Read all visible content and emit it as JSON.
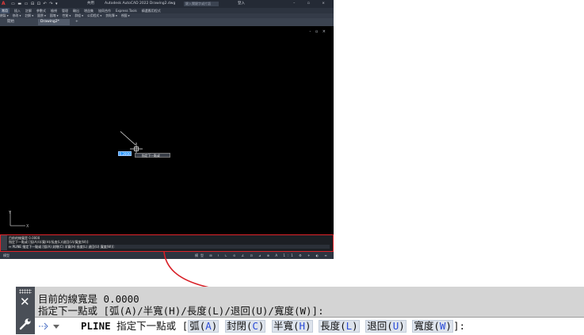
{
  "titlebar": {
    "logo": "A",
    "share": "共用",
    "title": "Autodesk AutoCAD 2022    Drawing2.dwg",
    "search_placeholder": "鍵入關鍵字或片語",
    "user": "登入"
  },
  "ribbon_tabs": [
    "常用",
    "插入",
    "註解",
    "參數式",
    "檢視",
    "管理",
    "輸出",
    "增益集",
    "協同合作",
    "Express Tools",
    "精選應用程式"
  ],
  "ribbon_panels": [
    "繪製",
    "修改",
    "註解",
    "圖層",
    "圖塊",
    "性質",
    "群組",
    "公用程式",
    "剪貼簿",
    "視圖"
  ],
  "doc_tabs": {
    "start": "開始",
    "drawing": "Drawing2*",
    "add": "+"
  },
  "viewport_controls": "- ▫ ×",
  "small_cmd": {
    "line1": "目前的線寬是 0.0000",
    "line2": "指定下一點或 [弧(A)/半寬(H)/長度(L)/退回(U)/寬度(W)]:",
    "line3": "↔ PLINE 指定下一點或 [弧(A) 封閉(C) 半寬(H) 長度(L) 退回(U) 寬度(W)]:"
  },
  "statusbar": {
    "left": "模型",
    "right": "模型 ⊞ ⁞ ∟ ⊙ ∠ ⊡ ⊿ ⊕ A 1:1 ⚙ + ◐ ≡"
  },
  "dynamic_input": {
    "value": "0.2000",
    "tooltip": "指定下一點或"
  },
  "zoomed_cmd": {
    "history_line1": "目前的線寬是 0.0000",
    "history_line2": "指定下一點或 [弧(A)/半寬(H)/長度(L)/退回(U)/寬度(W)]:",
    "command_name": "PLINE",
    "prompt_text": "指定下一點或 [",
    "options": [
      {
        "label": "弧(",
        "key": "A",
        "close": ")"
      },
      {
        "label": "封閉(",
        "key": "C",
        "close": ")"
      },
      {
        "label": "半寬(",
        "key": "H",
        "close": ")"
      },
      {
        "label": "長度(",
        "key": "L",
        "close": ")"
      },
      {
        "label": "退回(",
        "key": "U",
        "close": ")"
      },
      {
        "label": "寬度(",
        "key": "W",
        "close": ")"
      }
    ],
    "prompt_end": "]:"
  },
  "colors": {
    "highlight_border": "#e0232a",
    "arrow": "#d81f26",
    "option_key": "#2a4bd7",
    "canvas": "#000000"
  }
}
